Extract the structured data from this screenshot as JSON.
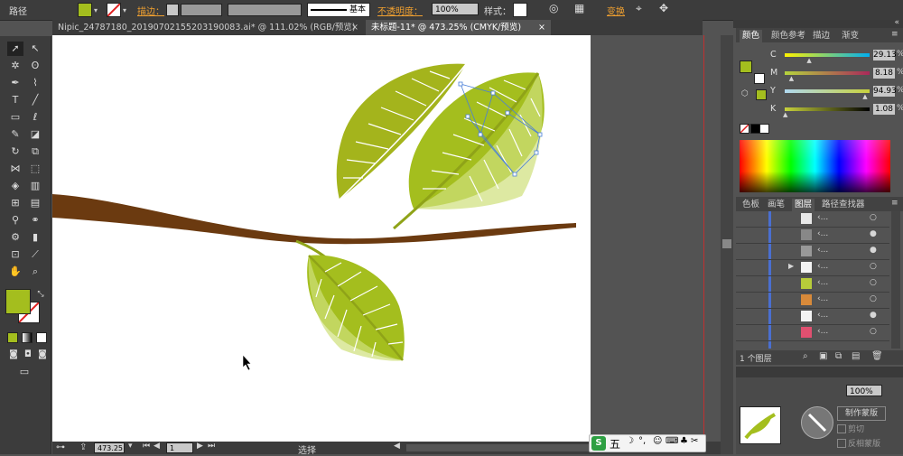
{
  "control_bar": {
    "object_type": "路径",
    "fill_color": "#a4be1e",
    "stroke_label": "描边：",
    "stroke_style": "基本",
    "opacity_label": "不透明度：",
    "opacity_value": "100%",
    "style_label": "样式：",
    "transform_label": "变换"
  },
  "document_tabs": [
    {
      "label": "Nipic_24787180_20190702155203190083.ai* @ 111.02% (RGB/预览)"
    },
    {
      "label": "未标题-11* @ 473.25% (CMYK/预览)"
    }
  ],
  "status_bar": {
    "zoom": "473.25",
    "page": "1",
    "tool_label": "选择"
  },
  "color_panel": {
    "tabs": [
      "颜色",
      "颜色参考",
      "描边",
      "渐变"
    ],
    "channels": [
      {
        "name": "C",
        "value": "29.13",
        "percent": 29.13,
        "gradient": "linear-gradient(90deg,#fff200,#00aeef)"
      },
      {
        "name": "M",
        "value": "8.18",
        "percent": 8.18,
        "gradient": "linear-gradient(90deg,#b5d33d,#a9295a)"
      },
      {
        "name": "Y",
        "value": "94.93",
        "percent": 94.93,
        "gradient": "linear-gradient(90deg,#b0d8f0,#c8d23c)"
      },
      {
        "name": "K",
        "value": "1.08",
        "percent": 1.08,
        "gradient": "linear-gradient(90deg,#c8d23c,#000)"
      }
    ],
    "percent_sign": "%"
  },
  "layers_panel": {
    "tabs": [
      "色板",
      "画笔",
      "图层",
      "路径查找器"
    ],
    "footer_count": "1 个图层"
  },
  "bottom_panel": {
    "opacity_value": "100%",
    "make_mask_label": "制作蒙版",
    "clip_label": "剪切",
    "invert_label": "反相蒙版"
  },
  "ime_bar": {
    "mode": "五"
  }
}
